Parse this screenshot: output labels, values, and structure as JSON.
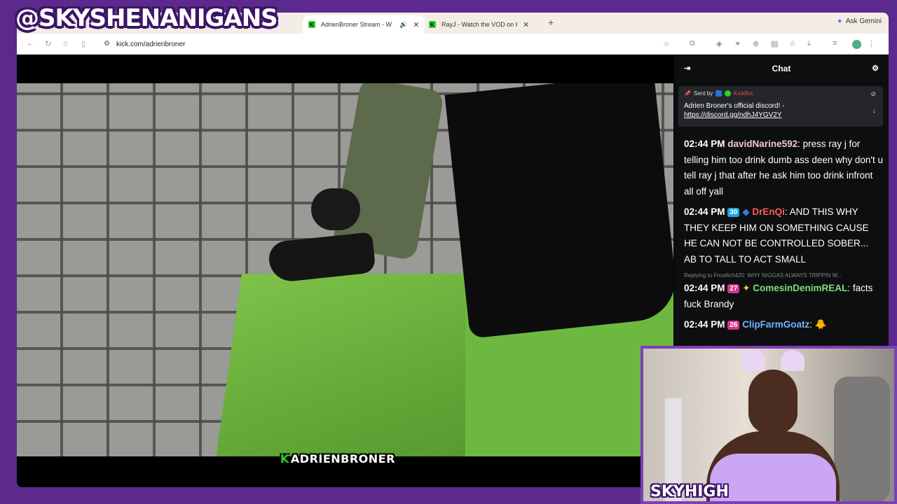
{
  "overlay": {
    "handle": "@SKYSHENANIGANS",
    "cam_label": "SKYHIGH"
  },
  "browser": {
    "tabs": [
      {
        "title": "AdrienBroner Stream - W",
        "active": true
      },
      {
        "title": "RayJ - Watch the VOD on Kic",
        "active": false
      }
    ],
    "new_tab": "+",
    "gemini": "Ask Gemini",
    "url": "kick.com/adrienbroner"
  },
  "video": {
    "watermark": "ADRIENBRONER",
    "watermark_k": "K"
  },
  "chat": {
    "title": "Chat",
    "pinned": {
      "sent_by": "Sent by",
      "bot": "KickBot",
      "message": "Adrien Broner's official discord! -",
      "link": "https://discord.gg/ndhJ4YGV2Y"
    },
    "messages": [
      {
        "time": "02:44 PM",
        "badge": "",
        "user": "davidNarine592",
        "user_color": "#f3c7c7",
        "text": "press ray j for telling him too drink dumb ass deen why don't u tell ray j that after he ask him too drink infront all off yall"
      },
      {
        "time": "02:44 PM",
        "badge": "30",
        "badge_color": "#1aa6e0",
        "user": "DrEnQi",
        "user_color": "#ff5a5a",
        "text": "AND THIS WHY THEY KEEP HIM ON SOMETHING CAUSE HE CAN NOT BE CONTROLLED SOBER... AB TO TALL TO ACT SMALL"
      },
      {
        "reply": "Replying to Frostlich420: WHY NIGGAS ALWAYS TRIPPIN W...",
        "time": "02:44 PM",
        "badge": "27",
        "badge_color": "#d6338a",
        "user": "ComesinDenimREAL",
        "user_color": "#7ee07e",
        "text": "facts fuck Brandy"
      },
      {
        "time": "02:44 PM",
        "badge": "26",
        "badge_color": "#d6338a",
        "user": "ClipFarmGoatz",
        "user_color": "#6fb6ff",
        "text": "🐥"
      }
    ]
  }
}
